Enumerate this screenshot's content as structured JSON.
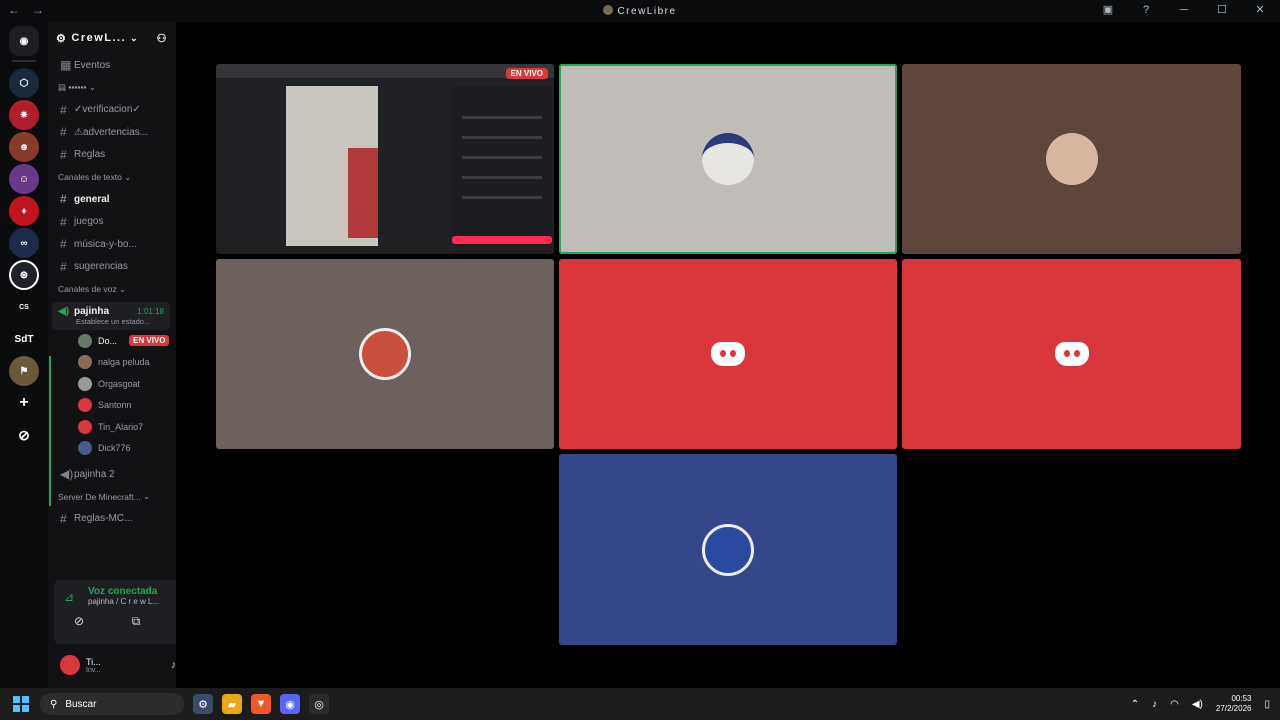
{
  "window": {
    "title": "CrewLibre",
    "back": "←",
    "forward": "→"
  },
  "server": {
    "name": "CrewL...",
    "events": "Eventos",
    "channels_top": [
      {
        "name": "✓verificacion✓"
      },
      {
        "name": "⚠advertencias..."
      },
      {
        "name": "Reglas"
      }
    ],
    "cat_text": "Canales de texto",
    "text_channels": [
      {
        "name": "general"
      },
      {
        "name": "juegos"
      },
      {
        "name": "música-y-bo..."
      },
      {
        "name": "sugerencias"
      }
    ],
    "cat_voice": "Canales de voz",
    "voice_channel": {
      "name": "pajinha",
      "timer": "1:01:18",
      "status": "Establece un estado..."
    },
    "voice_users": [
      {
        "name": "Do...",
        "live": "EN VIVO",
        "color": "#6a7a6a"
      },
      {
        "name": "nalga peluda",
        "color": "#8a6a5a"
      },
      {
        "name": "Orgasgoat",
        "color": "#9a9a9a"
      },
      {
        "name": "Santonn",
        "color": "#da373c"
      },
      {
        "name": "Tin_Alario7",
        "color": "#da373c"
      },
      {
        "name": "Dick776",
        "color": "#4a5a8a"
      }
    ],
    "voice_channel_2": "pajinha 2",
    "cat_mc": "Server De Minecraft...",
    "mc_channel": "Reglas-MC..."
  },
  "voice_panel": {
    "status": "Voz conectada",
    "sub": "pajinha / C r e w L..."
  },
  "user": {
    "name": "Ti...",
    "status": "Inv..."
  },
  "stage": {
    "live_label": "EN VIVO",
    "tiles": [
      {
        "type": "screen",
        "color": "#202124"
      },
      {
        "type": "avatar",
        "color": "#c0bcb8",
        "av": "#e8e6e2",
        "speaking": true
      },
      {
        "type": "avatar",
        "color": "#5e463c",
        "av": "#d4b8a2"
      },
      {
        "type": "avatar",
        "color": "#6e615d",
        "av": "#c8503c"
      },
      {
        "type": "logo",
        "color": "#da373c"
      },
      {
        "type": "logo",
        "color": "#da373c"
      },
      {
        "type": "avatar",
        "color": "#36468a",
        "av": "#2a4aa0"
      }
    ]
  },
  "taskbar": {
    "search": "Buscar",
    "time": "00:53",
    "date": "27/2/2026"
  }
}
